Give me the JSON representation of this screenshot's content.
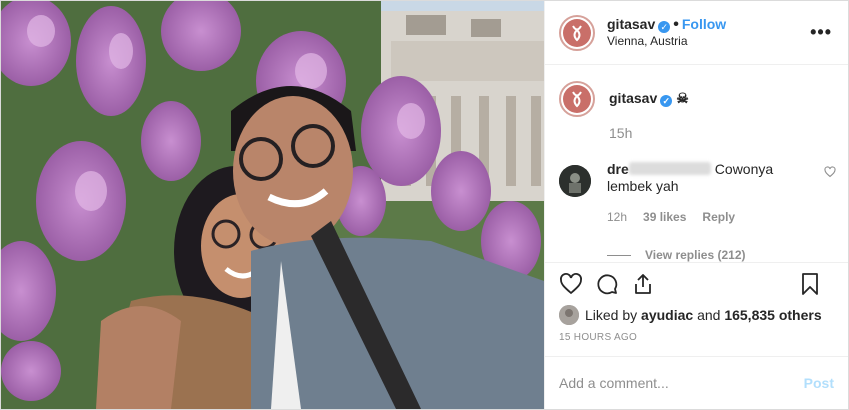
{
  "post": {
    "username": "gitasav",
    "follow_label": "Follow",
    "separator": "•",
    "location": "Vienna, Austria",
    "more_label": "•••"
  },
  "caption": {
    "username": "gitasav",
    "emoji": "☠",
    "time": "15h"
  },
  "comment": {
    "username_visible": "dre",
    "text": "Cowonya lembek yah",
    "time": "12h",
    "likes": "39 likes",
    "reply_label": "Reply",
    "view_replies": "View replies (212)"
  },
  "likes": {
    "prefix": "Liked by",
    "user": "ayudiac",
    "middle": "and",
    "count": "165,835 others"
  },
  "timestamp": "15 HOURS AGO",
  "add_comment": {
    "placeholder": "Add a comment...",
    "post_label": "Post"
  },
  "colors": {
    "link_blue": "#3897f0",
    "post_disabled": "#b2dffc",
    "meta_gray": "#8e8e8e",
    "avatar_bg": "#c96f69"
  },
  "icons": [
    "heart-icon",
    "comment-icon",
    "share-icon",
    "bookmark-icon",
    "verified-icon",
    "more-icon",
    "small-heart-icon"
  ]
}
